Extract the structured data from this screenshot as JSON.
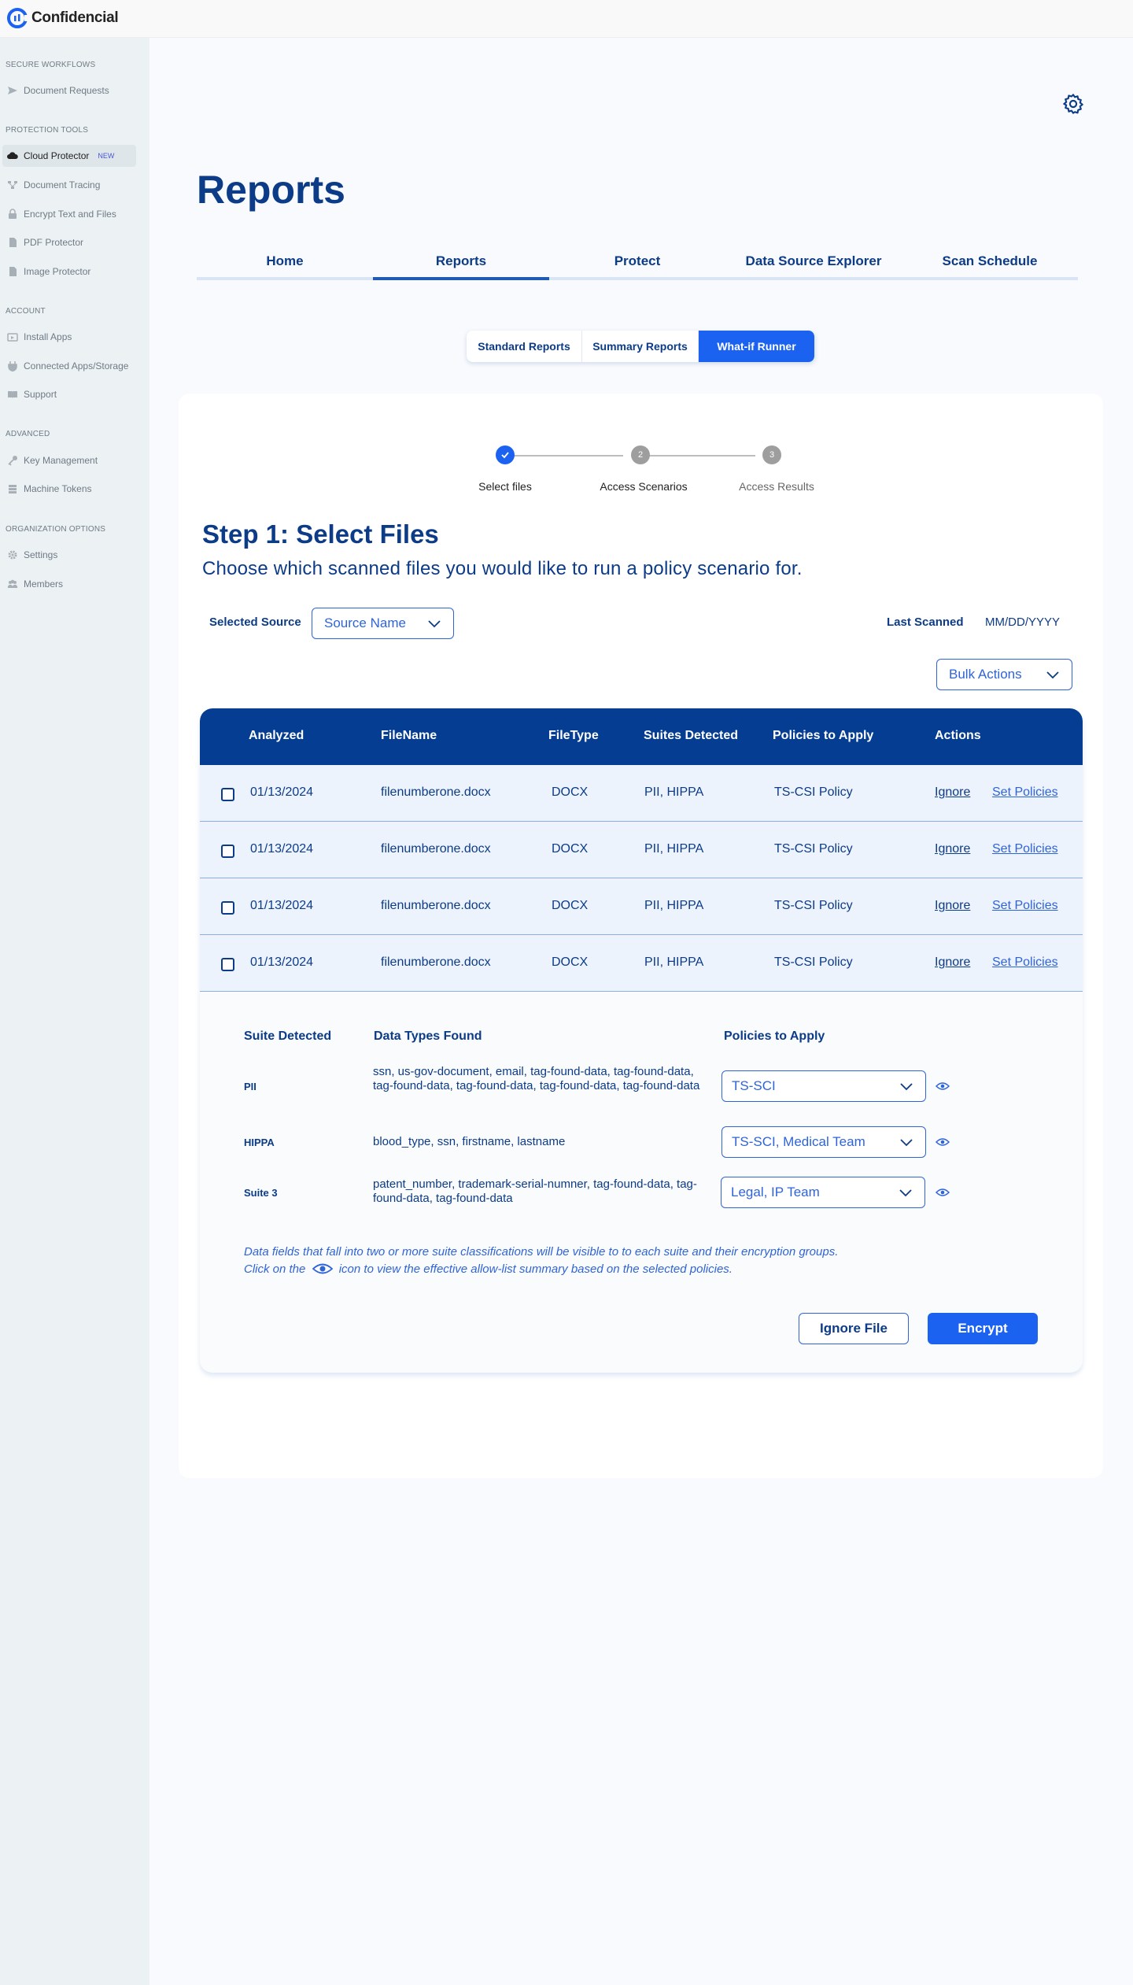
{
  "brand": {
    "name": "Confidencial",
    "color": "#1b62f0"
  },
  "sidebar": {
    "sections": [
      {
        "title": "SECURE WORKFLOWS",
        "items": [
          {
            "label": "Document Requests",
            "icon": "send-icon"
          }
        ]
      },
      {
        "title": "PROTECTION TOOLS",
        "items": [
          {
            "label": "Cloud Protector",
            "icon": "cloud-icon",
            "badge": "NEW",
            "active": true
          },
          {
            "label": "Document Tracing",
            "icon": "tracing-icon"
          },
          {
            "label": "Encrypt Text and Files",
            "icon": "lock-icon"
          },
          {
            "label": "PDF Protector",
            "icon": "pdf-icon"
          },
          {
            "label": "Image Protector",
            "icon": "image-icon"
          }
        ]
      },
      {
        "title": "ACCOUNT",
        "items": [
          {
            "label": "Install Apps",
            "icon": "install-icon"
          },
          {
            "label": "Connected Apps/Storage",
            "icon": "plug-icon"
          },
          {
            "label": "Support",
            "icon": "book-icon"
          }
        ]
      },
      {
        "title": "ADVANCED",
        "items": [
          {
            "label": "Key Management",
            "icon": "key-icon"
          },
          {
            "label": "Machine Tokens",
            "icon": "token-icon"
          }
        ]
      },
      {
        "title": "ORGANIZATION OPTIONS",
        "items": [
          {
            "label": "Settings",
            "icon": "gear-icon"
          },
          {
            "label": "Members",
            "icon": "members-icon"
          }
        ]
      }
    ]
  },
  "header": {
    "title": "Reports",
    "tabs": [
      "Home",
      "Reports",
      "Protect",
      "Data Source Explorer",
      "Scan Schedule"
    ],
    "active_tab": "Reports"
  },
  "subtabs": {
    "items": [
      "Standard Reports",
      "Summary Reports",
      "What-if Runner"
    ],
    "active": "What-if Runner"
  },
  "stepper": {
    "steps": [
      {
        "number": "1",
        "label": "Select files",
        "state": "done"
      },
      {
        "number": "2",
        "label": "Access Scenarios",
        "state": "pending"
      },
      {
        "number": "3",
        "label": "Access Results",
        "state": "pending"
      }
    ]
  },
  "step": {
    "title": "Step 1: Select Files",
    "subtitle": "Choose which scanned files you would like to run a policy scenario for."
  },
  "filters": {
    "selected_source_label": "Selected Source",
    "selected_source_value": "Source Name",
    "last_scanned_label": "Last Scanned",
    "last_scanned_value": "MM/DD/YYYY",
    "bulk_actions": "Bulk Actions"
  },
  "table": {
    "headers": [
      "Analyzed",
      "FileName",
      "FileType",
      "Suites Detected",
      "Policies to Apply",
      "Actions"
    ],
    "rows": [
      {
        "analyzed": "01/13/2024",
        "filename": "filenumberone.docx",
        "filetype": "DOCX",
        "suites": "PII, HIPPA",
        "policies": "TS-CSI Policy",
        "action1": "Ignore",
        "action2": "Set Policies"
      },
      {
        "analyzed": "01/13/2024",
        "filename": "filenumberone.docx",
        "filetype": "DOCX",
        "suites": "PII, HIPPA",
        "policies": "TS-CSI Policy",
        "action1": "Ignore",
        "action2": "Set Policies"
      },
      {
        "analyzed": "01/13/2024",
        "filename": "filenumberone.docx",
        "filetype": "DOCX",
        "suites": "PII, HIPPA",
        "policies": "TS-CSI Policy",
        "action1": "Ignore",
        "action2": "Set Policies"
      },
      {
        "analyzed": "01/13/2024",
        "filename": "filenumberone.docx",
        "filetype": "DOCX",
        "suites": "PII, HIPPA",
        "policies": "TS-CSI Policy",
        "action1": "Ignore",
        "action2": "Set Policies"
      }
    ]
  },
  "detail": {
    "headers": {
      "suite": "Suite Detected",
      "types": "Data Types Found",
      "policies": "Policies to Apply"
    },
    "rows": [
      {
        "suite": "PII",
        "types": "ssn, us-gov-document, email, tag-found-data, tag-found-data, tag-found-data, tag-found-data, tag-found-data, tag-found-data",
        "policy": "TS-SCI"
      },
      {
        "suite": "HIPPA",
        "types": "blood_type, ssn, firstname, lastname",
        "policy": "TS-SCI, Medical Team"
      },
      {
        "suite": "Suite 3",
        "types": "patent_number, trademark-serial-numner, tag-found-data, tag-found-data, tag-found-data",
        "policy": "Legal, IP Team"
      }
    ],
    "note_line1": "Data fields that fall into two or more suite classifications will be visible to to each suite and their encryption groups.",
    "note_line2_pre": "Click on the",
    "note_line2_post": "icon to view the effective allow-list summary based on the selected policies.",
    "ignore_button": "Ignore File",
    "encrypt_button": "Encrypt"
  }
}
